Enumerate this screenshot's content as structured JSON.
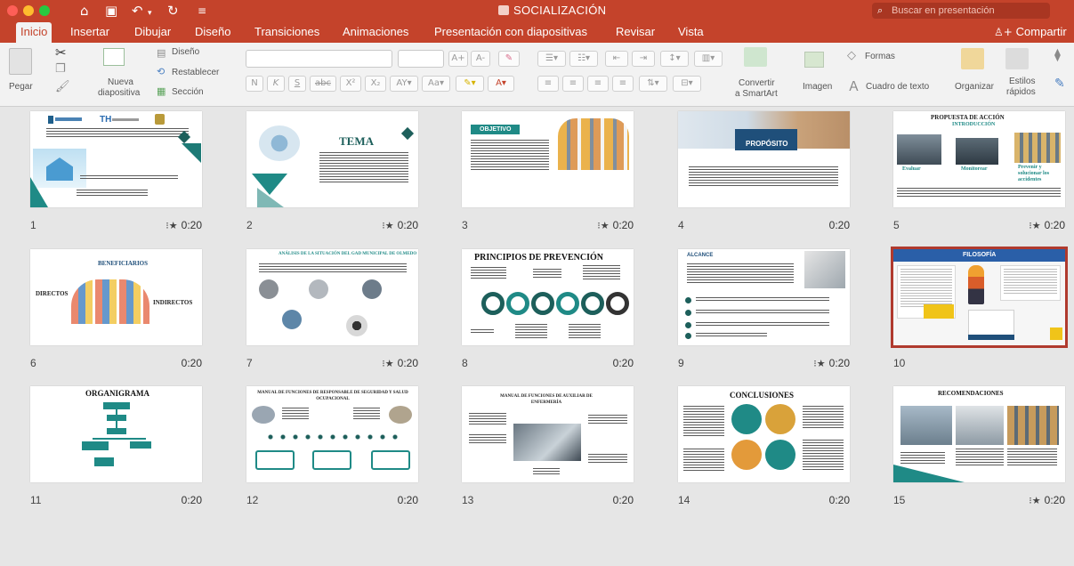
{
  "window": {
    "title": "SOCIALIZACIÓN",
    "search_placeholder": "Buscar en presentación"
  },
  "quick_access": [
    "home-icon",
    "save-icon",
    "undo-icon",
    "redo-icon",
    "customize-icon"
  ],
  "tabs": [
    "Inicio",
    "Insertar",
    "Dibujar",
    "Diseño",
    "Transiciones",
    "Animaciones",
    "Presentación con diapositivas",
    "Revisar",
    "Vista"
  ],
  "share_label": "Compartir",
  "ribbon": {
    "paste": "Pegar",
    "new_slide_line1": "Nueva",
    "new_slide_line2": "diapositiva",
    "layout": "Diseño",
    "reset": "Restablecer",
    "section": "Sección",
    "convert_line1": "Convertir",
    "convert_line2": "a SmartArt",
    "image": "Imagen",
    "textbox": "Cuadro de texto",
    "shapes": "Formas",
    "arrange": "Organizar",
    "styles_line1": "Estilos",
    "styles_line2": "rápidos",
    "font_buttons": [
      "N",
      "K",
      "S",
      "abc",
      "X²",
      "X₂"
    ]
  },
  "slides": [
    {
      "number": "1",
      "duration": "0:20",
      "has_animation": true,
      "title": ""
    },
    {
      "number": "2",
      "duration": "0:20",
      "has_animation": true,
      "title": "TEMA"
    },
    {
      "number": "3",
      "duration": "0:20",
      "has_animation": true,
      "title": "OBJETIVO"
    },
    {
      "number": "4",
      "duration": "0:20",
      "has_animation": false,
      "title": "PROPÓSITO"
    },
    {
      "number": "5",
      "duration": "0:20",
      "has_animation": true,
      "title": "PROPUESTA DE ACCIÓN",
      "subtitle": "INTRODUCCIÓN"
    },
    {
      "number": "6",
      "duration": "0:20",
      "has_animation": false,
      "title": "BENEFICIARIOS",
      "labels": [
        "DIRECTOS",
        "INDIRECTOS"
      ]
    },
    {
      "number": "7",
      "duration": "0:20",
      "has_animation": true,
      "title": "ANÁLISIS DE LA SITUACIÓN DEL GAD MUNICIPAL DE OLMEDO"
    },
    {
      "number": "8",
      "duration": "0:20",
      "has_animation": false,
      "title": "PRINCIPIOS DE PREVENCIÓN"
    },
    {
      "number": "9",
      "duration": "0:20",
      "has_animation": true,
      "title": "ALCANCE"
    },
    {
      "number": "10",
      "duration": "",
      "has_animation": false,
      "title": "FILOSOFÍA",
      "selected": true
    },
    {
      "number": "11",
      "duration": "0:20",
      "has_animation": false,
      "title": "ORGANIGRAMA"
    },
    {
      "number": "12",
      "duration": "0:20",
      "has_animation": false,
      "title": "MANUAL DE FUNCIONES DE RESPONSABLE DE SEGURIDAD Y SALUD OCUPACIONAL"
    },
    {
      "number": "13",
      "duration": "0:20",
      "has_animation": false,
      "title": "MANUAL DE FUNCIONES DE AUXILIAR DE ENFERMERÍA"
    },
    {
      "number": "14",
      "duration": "0:20",
      "has_animation": false,
      "title": "CONCLUSIONES"
    },
    {
      "number": "15",
      "duration": "0:20",
      "has_animation": true,
      "title": "RECOMENDACIONES"
    }
  ],
  "slide1": {
    "logo_text": "TH"
  },
  "slide5": {
    "labels": [
      "Evaluar",
      "Monitorear",
      "Prevenir y solucionar los accidentes"
    ]
  },
  "colors": {
    "accent": "#c4432b",
    "teal": "#1f8a86",
    "dark_teal": "#1d5f5b",
    "selected_border": "#b03a2e"
  }
}
